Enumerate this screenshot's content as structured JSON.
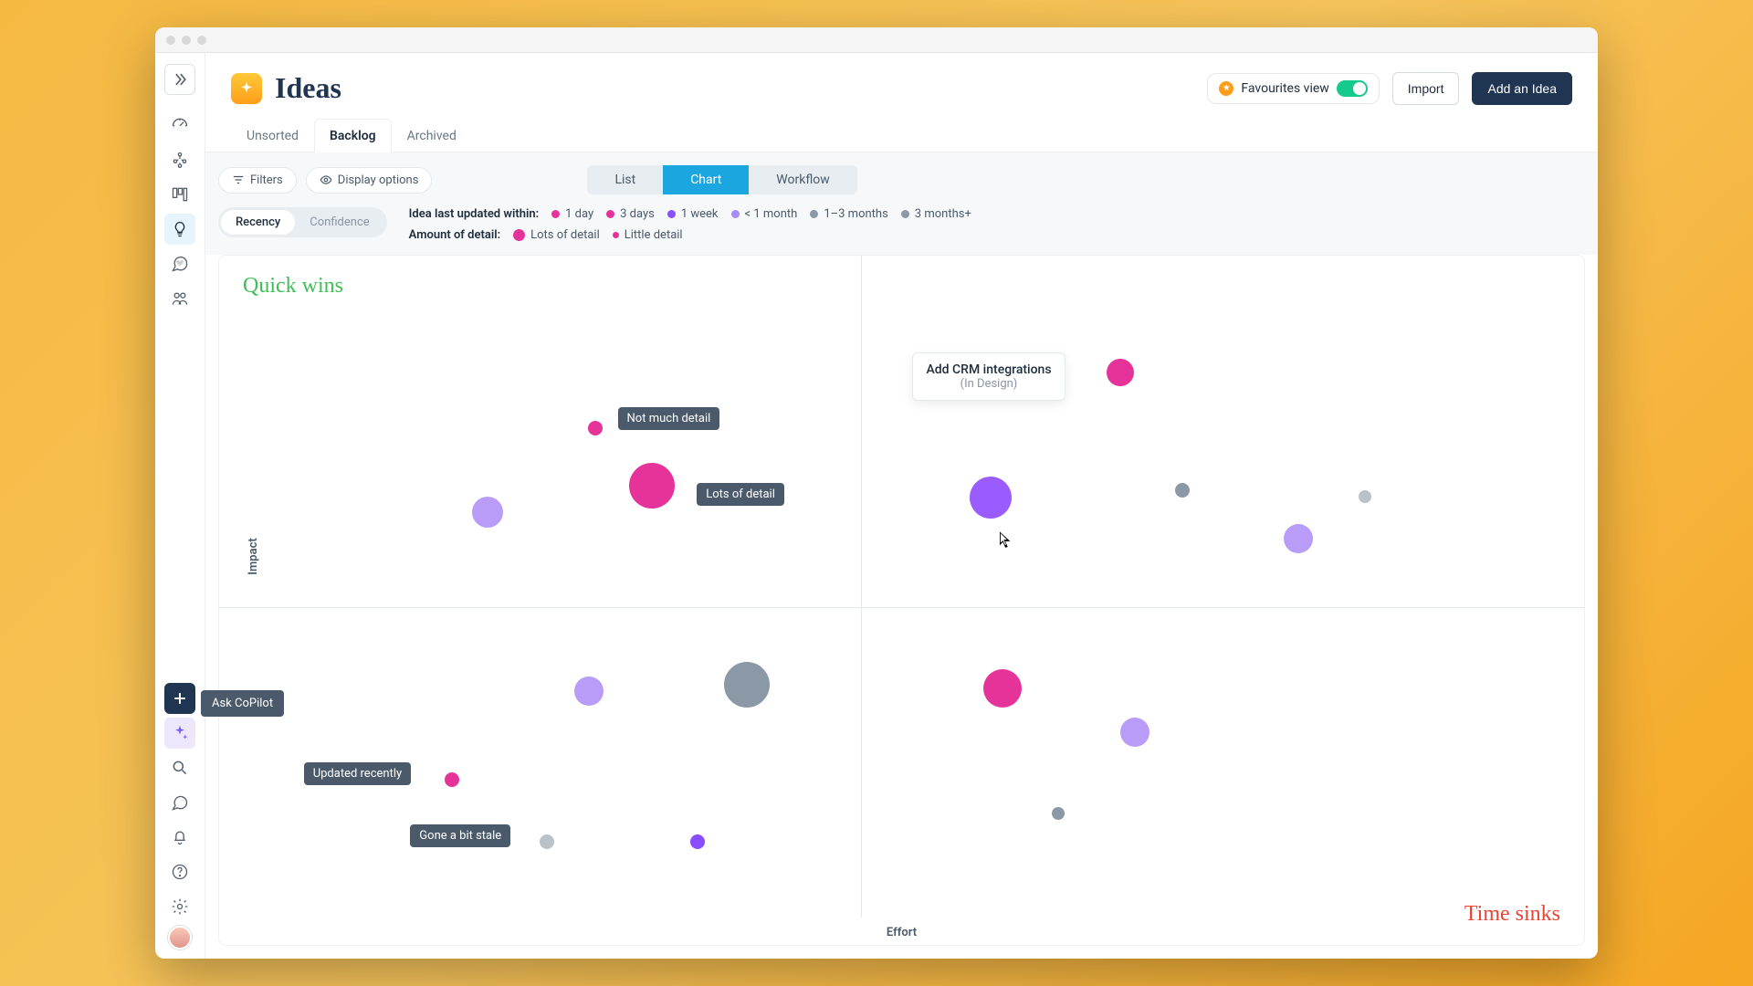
{
  "page": {
    "title": "Ideas"
  },
  "headerActions": {
    "favourites": "Favourites view",
    "import": "Import",
    "addIdea": "Add an Idea"
  },
  "tabs": [
    {
      "label": "Unsorted",
      "active": false
    },
    {
      "label": "Backlog",
      "active": true
    },
    {
      "label": "Archived",
      "active": false
    }
  ],
  "toolbar": {
    "filters": "Filters",
    "displayOptions": "Display options"
  },
  "viewSwitch": [
    {
      "label": "List",
      "active": false
    },
    {
      "label": "Chart",
      "active": true
    },
    {
      "label": "Workflow",
      "active": false
    }
  ],
  "modeSwitch": [
    {
      "label": "Recency",
      "active": true
    },
    {
      "label": "Confidence",
      "active": false
    }
  ],
  "legends": {
    "recency": {
      "label": "Idea last updated within:",
      "items": [
        {
          "label": "1 day",
          "color": "#e6339a"
        },
        {
          "label": "3 days",
          "color": "#e6339a"
        },
        {
          "label": "1 week",
          "color": "#8a4cff"
        },
        {
          "label": "< 1 month",
          "color": "#a78bfa"
        },
        {
          "label": "1–3 months",
          "color": "#8b98a5"
        },
        {
          "label": "3 months+",
          "color": "#8b98a5"
        }
      ]
    },
    "detail": {
      "label": "Amount of detail:",
      "big": "Lots of detail",
      "small": "Little detail",
      "color": "#e6339a"
    }
  },
  "quadrants": {
    "topLeft": "Quick wins",
    "bottomRight": "Time sinks"
  },
  "axes": {
    "x": "Effort",
    "y": "Impact"
  },
  "annotations": {
    "notMuch": "Not much detail",
    "lots": "Lots of detail",
    "recent": "Updated recently",
    "stale": "Gone a bit stale"
  },
  "popup": {
    "title": "Add CRM integrations",
    "status": "(In Design)"
  },
  "copilot": "Ask CoPilot",
  "chart_data": {
    "type": "scatter",
    "xlabel": "Effort",
    "ylabel": "Impact",
    "series_meta": {
      "color_encodes": "recency",
      "size_encodes": "amount_of_detail"
    },
    "points": [
      {
        "effort": 27,
        "impact": 72,
        "recency": "1 day",
        "size": 14,
        "color": "#e6339a",
        "label": "Not much detail"
      },
      {
        "effort": 21,
        "impact": 55,
        "recency": "< 1 month",
        "size": 28,
        "color": "#b89cf7"
      },
      {
        "effort": 31,
        "impact": 58,
        "recency": "1 day",
        "size": 40,
        "color": "#e6339a",
        "label": "Lots of detail"
      },
      {
        "effort": 56,
        "impact": 62,
        "recency": "1 week",
        "size": 36,
        "color": "#9a5cff",
        "label": "Add CRM integrations",
        "status": "In Design"
      },
      {
        "effort": 65,
        "impact": 77,
        "recency": "1 day",
        "size": 24,
        "color": "#e6339a"
      },
      {
        "effort": 69,
        "impact": 57,
        "recency": "1–3 months",
        "size": 14,
        "color": "#8b98a5"
      },
      {
        "effort": 77,
        "impact": 50,
        "recency": "< 1 month",
        "size": 26,
        "color": "#b89cf7"
      },
      {
        "effort": 82,
        "impact": 55,
        "recency": "3 months+",
        "size": 12,
        "color": "#b9c1c9"
      },
      {
        "effort": 26,
        "impact": 35,
        "recency": "< 1 month",
        "size": 26,
        "color": "#b89cf7"
      },
      {
        "effort": 36,
        "impact": 32,
        "recency": "1–3 months",
        "size": 40,
        "color": "#8b98a5"
      },
      {
        "effort": 17,
        "impact": 20,
        "recency": "1 day",
        "size": 14,
        "color": "#e6339a",
        "label": "Updated recently"
      },
      {
        "effort": 22,
        "impact": 11,
        "recency": "3 months+",
        "size": 14,
        "color": "#b9c1c9",
        "label": "Gone a bit stale"
      },
      {
        "effort": 33,
        "impact": 10,
        "recency": "1 week",
        "size": 14,
        "color": "#8a4cff"
      },
      {
        "effort": 58,
        "impact": 36,
        "recency": "1 day",
        "size": 34,
        "color": "#e6339a"
      },
      {
        "effort": 61,
        "impact": 14,
        "recency": "1–3 months",
        "size": 12,
        "color": "#8b98a5"
      },
      {
        "effort": 67,
        "impact": 28,
        "recency": "< 1 month",
        "size": 26,
        "color": "#b89cf7"
      }
    ]
  }
}
